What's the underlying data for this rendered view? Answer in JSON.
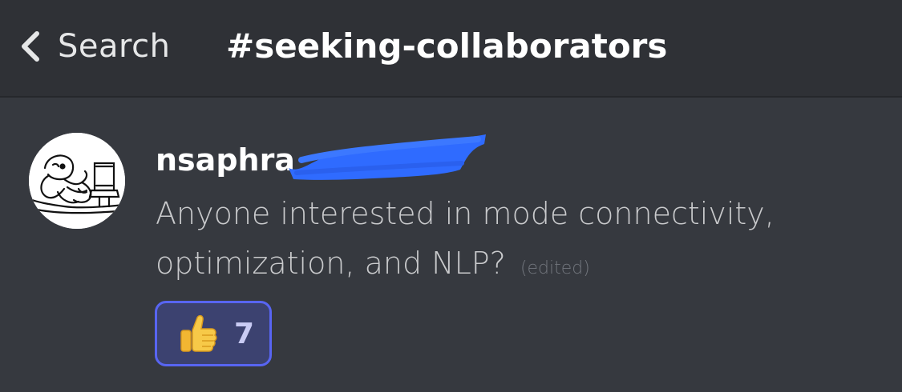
{
  "header": {
    "back_label": "Search",
    "channel": "#seeking-collaborators"
  },
  "message": {
    "username": "nsaphra",
    "body": "Anyone interested in mode connectivity, optimization, and NLP?",
    "edited_label": "(edited)",
    "reaction": {
      "emoji": "thumbs-up",
      "count": "7"
    }
  },
  "colors": {
    "background": "#36393f",
    "header_background": "#2f3136",
    "reaction_border": "#5865f2",
    "reaction_fill": "#3c4270",
    "redaction_marker": "#2f6bff"
  },
  "icons": {
    "back": "chevron-left-icon",
    "reaction": "thumbs-up-icon"
  }
}
